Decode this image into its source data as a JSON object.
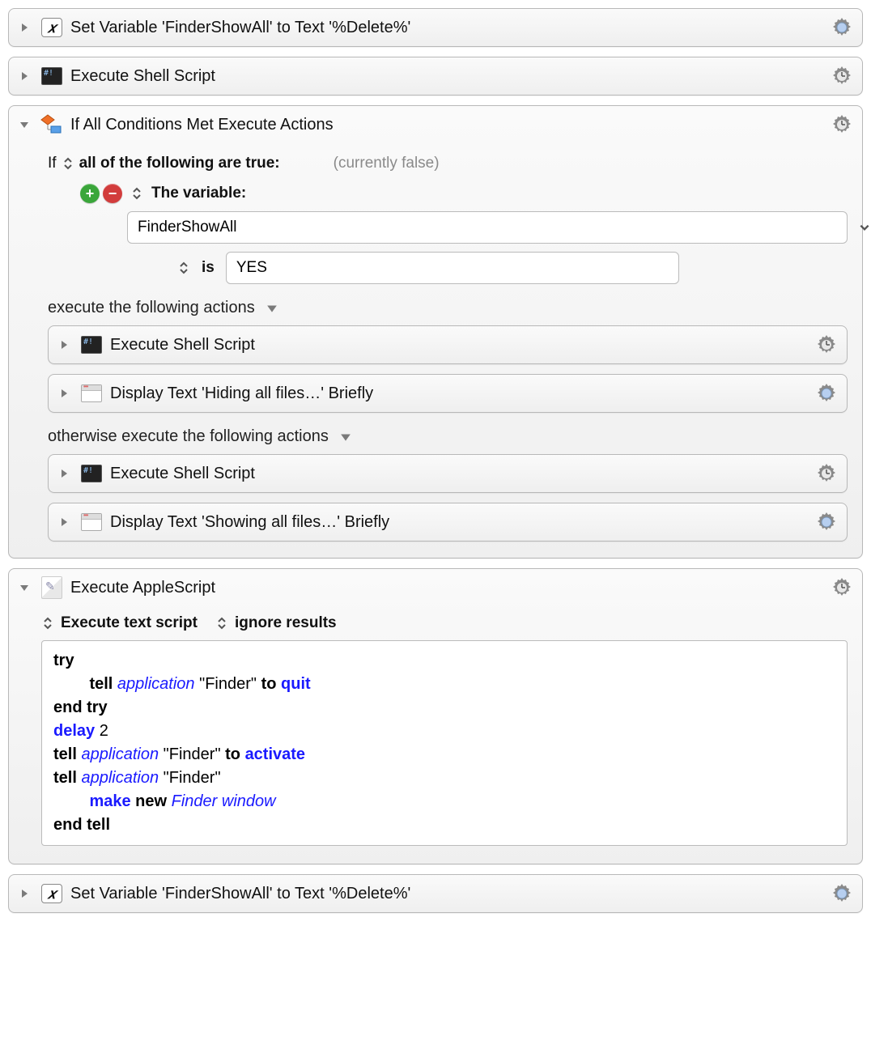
{
  "actions": [
    {
      "title": "Set Variable 'FinderShowAll' to Text '%Delete%'"
    },
    {
      "title": "Execute Shell Script"
    },
    {
      "title": "If All Conditions Met Execute Actions"
    },
    {
      "title": "Execute AppleScript"
    },
    {
      "title": "Set Variable 'FinderShowAll' to Text '%Delete%'"
    }
  ],
  "if_block": {
    "if_label": "If",
    "quantifier": "all of the following are true:",
    "status": "(currently false)",
    "cond_label": "The variable:",
    "variable_name": "FinderShowAll",
    "comparator": "is",
    "value": "YES",
    "then_label": "execute the following actions",
    "else_label": "otherwise execute the following actions",
    "then_actions": [
      {
        "title": "Execute Shell Script"
      },
      {
        "title": "Display Text 'Hiding all files…' Briefly"
      }
    ],
    "else_actions": [
      {
        "title": "Execute Shell Script"
      },
      {
        "title": "Display Text 'Showing all files…' Briefly"
      }
    ]
  },
  "applescript": {
    "opt1": "Execute text script",
    "opt2": "ignore results",
    "lines": [
      [
        {
          "t": "try",
          "c": "kw"
        }
      ],
      [
        {
          "t": "        ",
          "c": ""
        },
        {
          "t": "tell",
          "c": "kw"
        },
        {
          "t": " ",
          "c": ""
        },
        {
          "t": "application",
          "c": "cls"
        },
        {
          "t": " \"Finder\" ",
          "c": "str"
        },
        {
          "t": "to",
          "c": "kw"
        },
        {
          "t": " ",
          "c": ""
        },
        {
          "t": "quit",
          "c": "cmd"
        }
      ],
      [
        {
          "t": "end try",
          "c": "kw"
        }
      ],
      [
        {
          "t": "delay",
          "c": "cmd"
        },
        {
          "t": " 2",
          "c": "str"
        }
      ],
      [
        {
          "t": "tell",
          "c": "kw"
        },
        {
          "t": " ",
          "c": ""
        },
        {
          "t": "application",
          "c": "cls"
        },
        {
          "t": " \"Finder\" ",
          "c": "str"
        },
        {
          "t": "to",
          "c": "kw"
        },
        {
          "t": " ",
          "c": ""
        },
        {
          "t": "activate",
          "c": "cmd"
        }
      ],
      [
        {
          "t": "tell",
          "c": "kw"
        },
        {
          "t": " ",
          "c": ""
        },
        {
          "t": "application",
          "c": "cls"
        },
        {
          "t": " \"Finder\"",
          "c": "str"
        }
      ],
      [
        {
          "t": "        ",
          "c": ""
        },
        {
          "t": "make",
          "c": "cmd"
        },
        {
          "t": " ",
          "c": ""
        },
        {
          "t": "new",
          "c": "kw"
        },
        {
          "t": " ",
          "c": ""
        },
        {
          "t": "Finder window",
          "c": "cls"
        }
      ],
      [
        {
          "t": "end tell",
          "c": "kw"
        }
      ]
    ]
  }
}
